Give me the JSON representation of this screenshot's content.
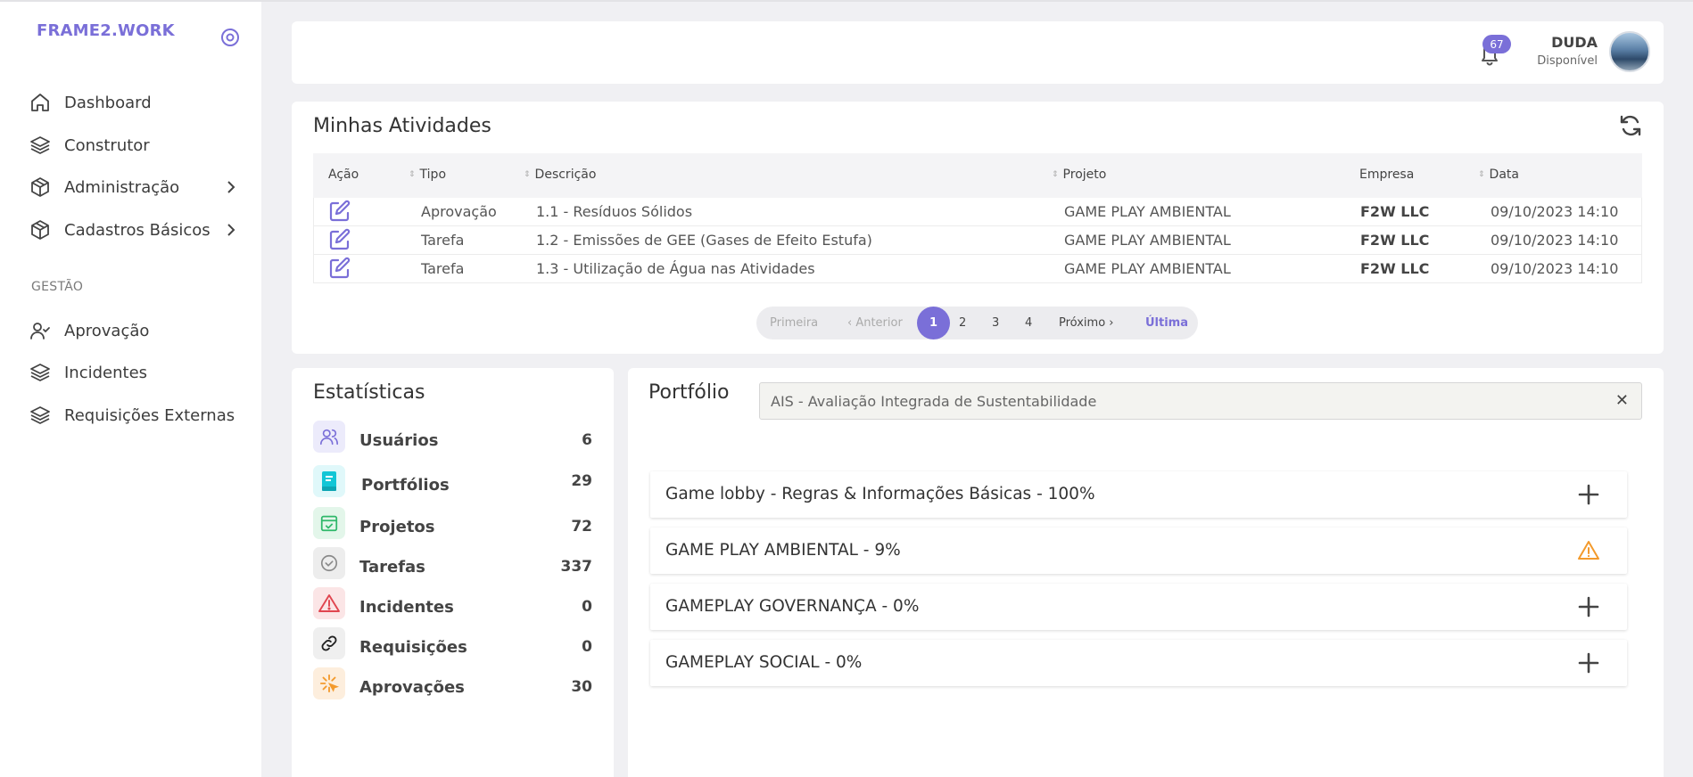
{
  "brand": "FRAME2.WORK",
  "sidebar": {
    "items": [
      {
        "label": "Dashboard",
        "icon": "home-icon"
      },
      {
        "label": "Construtor",
        "icon": "layers-icon"
      },
      {
        "label": "Administração",
        "icon": "box-icon"
      },
      {
        "label": "Cadastros Básicos",
        "icon": "box-icon"
      }
    ],
    "section": "GESTÃO",
    "gestao_items": [
      {
        "label": "Aprovação",
        "icon": "user-check-icon"
      },
      {
        "label": "Incidentes",
        "icon": "layers-icon"
      },
      {
        "label": "Requisições Externas",
        "icon": "layers-icon"
      }
    ]
  },
  "header": {
    "notifications": "67",
    "user_name": "DUDA",
    "user_status": "Disponível"
  },
  "activities": {
    "title": "Minhas Atividades",
    "columns": [
      "Ação",
      "Tipo",
      "Descrição",
      "Projeto",
      "Empresa",
      "Data"
    ],
    "rows": [
      {
        "tipo": "Aprovação",
        "descricao": "1.1 - Resíduos Sólidos",
        "projeto": "GAME PLAY AMBIENTAL",
        "empresa": "F2W LLC",
        "data": "09/10/2023 14:10"
      },
      {
        "tipo": "Tarefa",
        "descricao": "1.2 - Emissões de GEE (Gases de Efeito Estufa)",
        "projeto": "GAME PLAY AMBIENTAL",
        "empresa": "F2W LLC",
        "data": "09/10/2023 14:10"
      },
      {
        "tipo": "Tarefa",
        "descricao": "1.3 - Utilização de Água nas Atividades",
        "projeto": "GAME PLAY AMBIENTAL",
        "empresa": "F2W LLC",
        "data": "09/10/2023 14:10"
      }
    ],
    "pager": {
      "first": "Primeira",
      "prev": "‹ Anterior",
      "pages": [
        "1",
        "2",
        "3",
        "4"
      ],
      "next": "Próximo ›",
      "last": "Última"
    }
  },
  "stats": {
    "title": "Estatísticas",
    "items": [
      {
        "label": "Usuários",
        "value": "6",
        "icon": "users-icon",
        "color": "#7a6fd8",
        "bg": "#ecebfb"
      },
      {
        "label": "Portfólios",
        "value": "29",
        "icon": "book-icon",
        "color": "#12c6d6",
        "bg": "#e0f8fa"
      },
      {
        "label": "Projetos",
        "value": "72",
        "icon": "calendar-check-icon",
        "color": "#2fb86a",
        "bg": "#e3f6ea"
      },
      {
        "label": "Tarefas",
        "value": "337",
        "icon": "check-circle-icon",
        "color": "#8a8a8a",
        "bg": "#ededed"
      },
      {
        "label": "Incidentes",
        "value": "0",
        "icon": "alert-icon",
        "color": "#e0454f",
        "bg": "#fbe5e6"
      },
      {
        "label": "Requisições",
        "value": "0",
        "icon": "link-icon",
        "color": "#222222",
        "bg": "#efefef"
      },
      {
        "label": "Aprovações",
        "value": "30",
        "icon": "spark-icon",
        "color": "#f39a2c",
        "bg": "#fdeedd"
      }
    ]
  },
  "portfolio": {
    "title": "Portfólio",
    "selected": "AIS - Avaliação Integrada de Sustentabilidade",
    "clear": "✕",
    "items": [
      {
        "label": "Game lobby - Regras & Informações Básicas - 100%",
        "icon": "plus-icon"
      },
      {
        "label": "GAME PLAY AMBIENTAL - 9%",
        "icon": "warning-icon"
      },
      {
        "label": "GAMEPLAY GOVERNANÇA - 0%",
        "icon": "plus-icon"
      },
      {
        "label": "GAMEPLAY SOCIAL - 0%",
        "icon": "plus-icon"
      }
    ]
  }
}
